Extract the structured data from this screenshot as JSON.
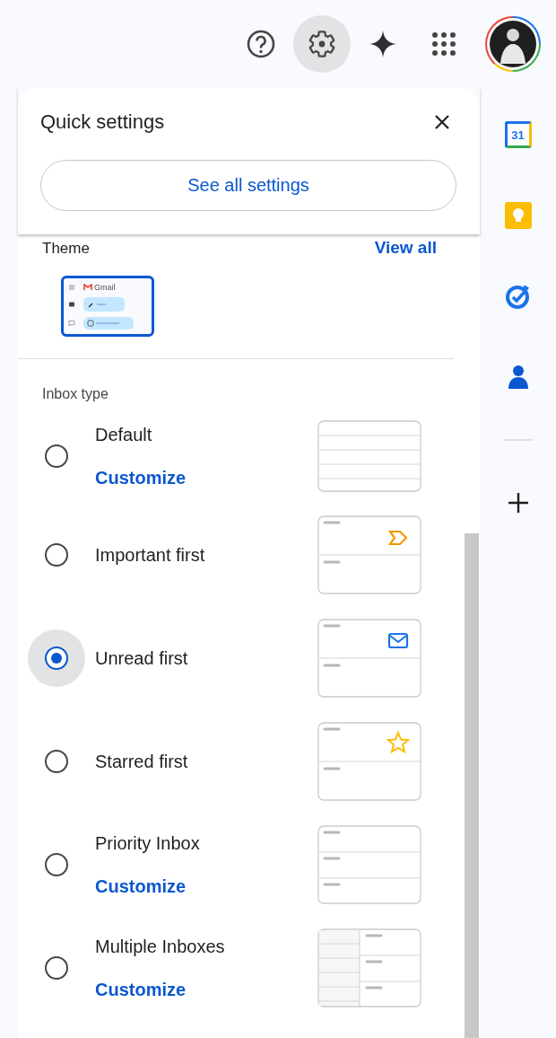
{
  "top_bar": {
    "icons": [
      {
        "kind": "help",
        "selected": false
      },
      {
        "kind": "settings",
        "selected": true
      },
      {
        "kind": "gemini",
        "selected": false
      },
      {
        "kind": "apps",
        "selected": false
      },
      {
        "kind": "avatar",
        "selected": false
      }
    ]
  },
  "quick_settings": {
    "title": "Quick settings",
    "see_all_button": "See all settings",
    "theme": {
      "label": "Theme",
      "view_all": "View all",
      "preview_label": "Gmail"
    },
    "inbox_type": {
      "label": "Inbox type",
      "options": [
        {
          "label": "Default",
          "selected": false,
          "customize": "Customize",
          "kind": "default"
        },
        {
          "label": "Important first",
          "selected": false,
          "kind": "important"
        },
        {
          "label": "Unread first",
          "selected": true,
          "kind": "unread"
        },
        {
          "label": "Starred first",
          "selected": false,
          "kind": "starred"
        },
        {
          "label": "Priority Inbox",
          "selected": false,
          "customize": "Customize",
          "kind": "priority"
        },
        {
          "label": "Multiple Inboxes",
          "selected": false,
          "customize": "Customize",
          "kind": "multiple"
        }
      ]
    }
  },
  "side_panel": {
    "apps": [
      {
        "kind": "calendar",
        "date": "31"
      },
      {
        "kind": "keep"
      },
      {
        "kind": "tasks"
      },
      {
        "kind": "contacts"
      }
    ]
  }
}
